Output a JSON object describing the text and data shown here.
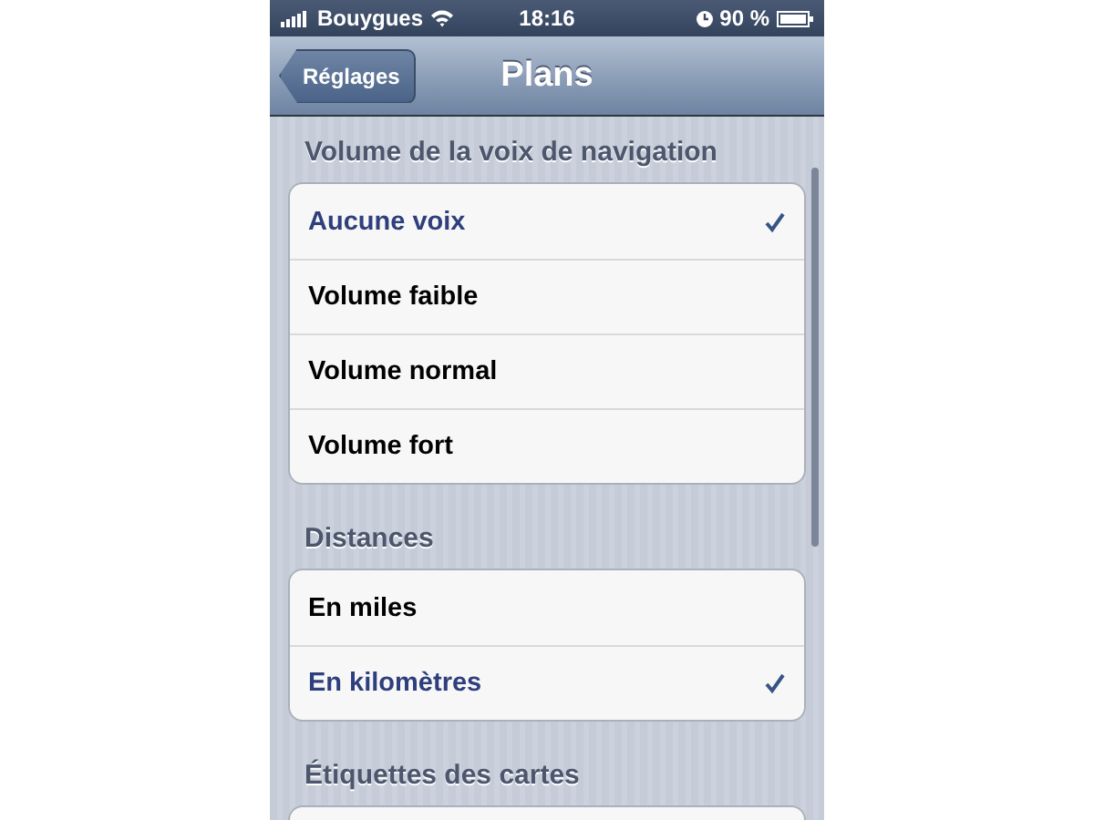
{
  "status_bar": {
    "carrier": "Bouygues",
    "time": "18:16",
    "battery": "90 %"
  },
  "nav_bar": {
    "back": "Réglages",
    "title": "Plans"
  },
  "sections": [
    {
      "header": "Volume de la voix de navigation",
      "rows": [
        {
          "label": "Aucune voix",
          "selected": true
        },
        {
          "label": "Volume faible",
          "selected": false
        },
        {
          "label": "Volume normal",
          "selected": false
        },
        {
          "label": "Volume fort",
          "selected": false
        }
      ]
    },
    {
      "header": "Distances",
      "rows": [
        {
          "label": "En miles",
          "selected": false
        },
        {
          "label": "En kilomètres",
          "selected": true
        }
      ]
    },
    {
      "header": "Étiquettes des cartes"
    }
  ]
}
